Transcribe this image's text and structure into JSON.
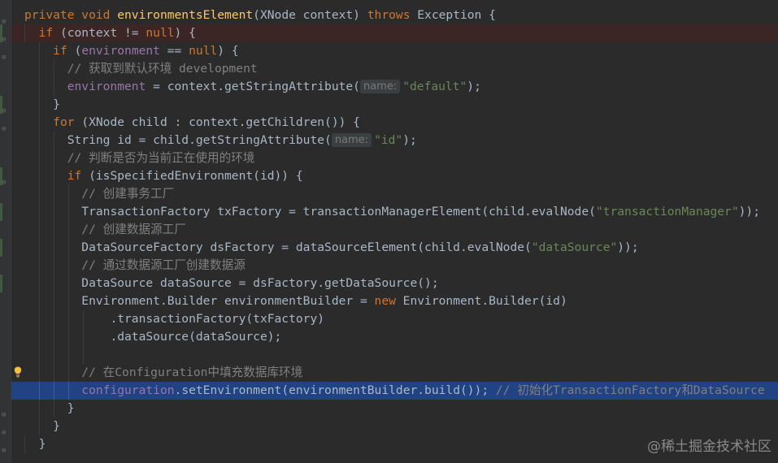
{
  "code": {
    "l1": {
      "kw1": "private void ",
      "fn": "environmentsElement",
      "t1": "(XNode context) ",
      "kw2": "throws",
      "t2": " Exception {"
    },
    "l2": {
      "kw1": "if",
      "t1": " (context != ",
      "kw2": "null",
      "t2": ") {"
    },
    "l3": {
      "kw1": "if",
      "t1": " (",
      "field": "environment",
      "t2": " == ",
      "kw2": "null",
      "t3": ") {"
    },
    "l4": {
      "cmt": "// 获取到默认环境 development"
    },
    "l5": {
      "field": "environment",
      "t1": " = context.getStringAttribute(",
      "hint": "name:",
      "str": "\"default\"",
      "t2": ");"
    },
    "l6": {
      "t1": "}"
    },
    "l7": {
      "kw1": "for",
      "t1": " (XNode child : context.getChildren()) {"
    },
    "l8": {
      "t1": "String id = child.getStringAttribute(",
      "hint": "name:",
      "str": "\"id\"",
      "t2": ");"
    },
    "l9": {
      "cmt": "// 判断是否为当前正在使用的环境"
    },
    "l10": {
      "kw1": "if",
      "t1": " (isSpecifiedEnvironment(id)) {"
    },
    "l11": {
      "cmt": "// 创建事务工厂"
    },
    "l12": {
      "t1": "TransactionFactory txFactory = transactionManagerElement(child.evalNode(",
      "str": "\"transactionManager\"",
      "t2": "));"
    },
    "l13": {
      "cmt": "// 创建数据源工厂"
    },
    "l14": {
      "t1": "DataSourceFactory dsFactory = dataSourceElement(child.evalNode(",
      "str": "\"dataSource\"",
      "t2": "));"
    },
    "l15": {
      "cmt": "// 通过数据源工厂创建数据源"
    },
    "l16": {
      "t1": "DataSource dataSource = dsFactory.getDataSource();"
    },
    "l17": {
      "t1": "Environment.Builder environmentBuilder = ",
      "kw1": "new",
      "t2": " Environment.Builder(id)"
    },
    "l18": {
      "t1": ".transactionFactory(txFactory)"
    },
    "l19": {
      "t1": ".dataSource(dataSource);"
    },
    "l21": {
      "cmt": "// 在Configuration中填充数据库环境"
    },
    "l22": {
      "field": "configuration",
      "t1": ".setEnvironment(environmentBuilder.build()); ",
      "cmt": "// 初始化TransactionFactory和DataSource"
    },
    "l23": {
      "t1": "}"
    },
    "l24": {
      "t1": "}"
    },
    "l25": {
      "t1": "}"
    }
  },
  "watermark": "@稀土掘金技术社区",
  "colors": {
    "keyword": "#cc7832",
    "function": "#ffc66d",
    "string": "#6a8759",
    "comment": "#808080",
    "field": "#9876aa",
    "text": "#a9b7c6",
    "selection": "#214283"
  }
}
